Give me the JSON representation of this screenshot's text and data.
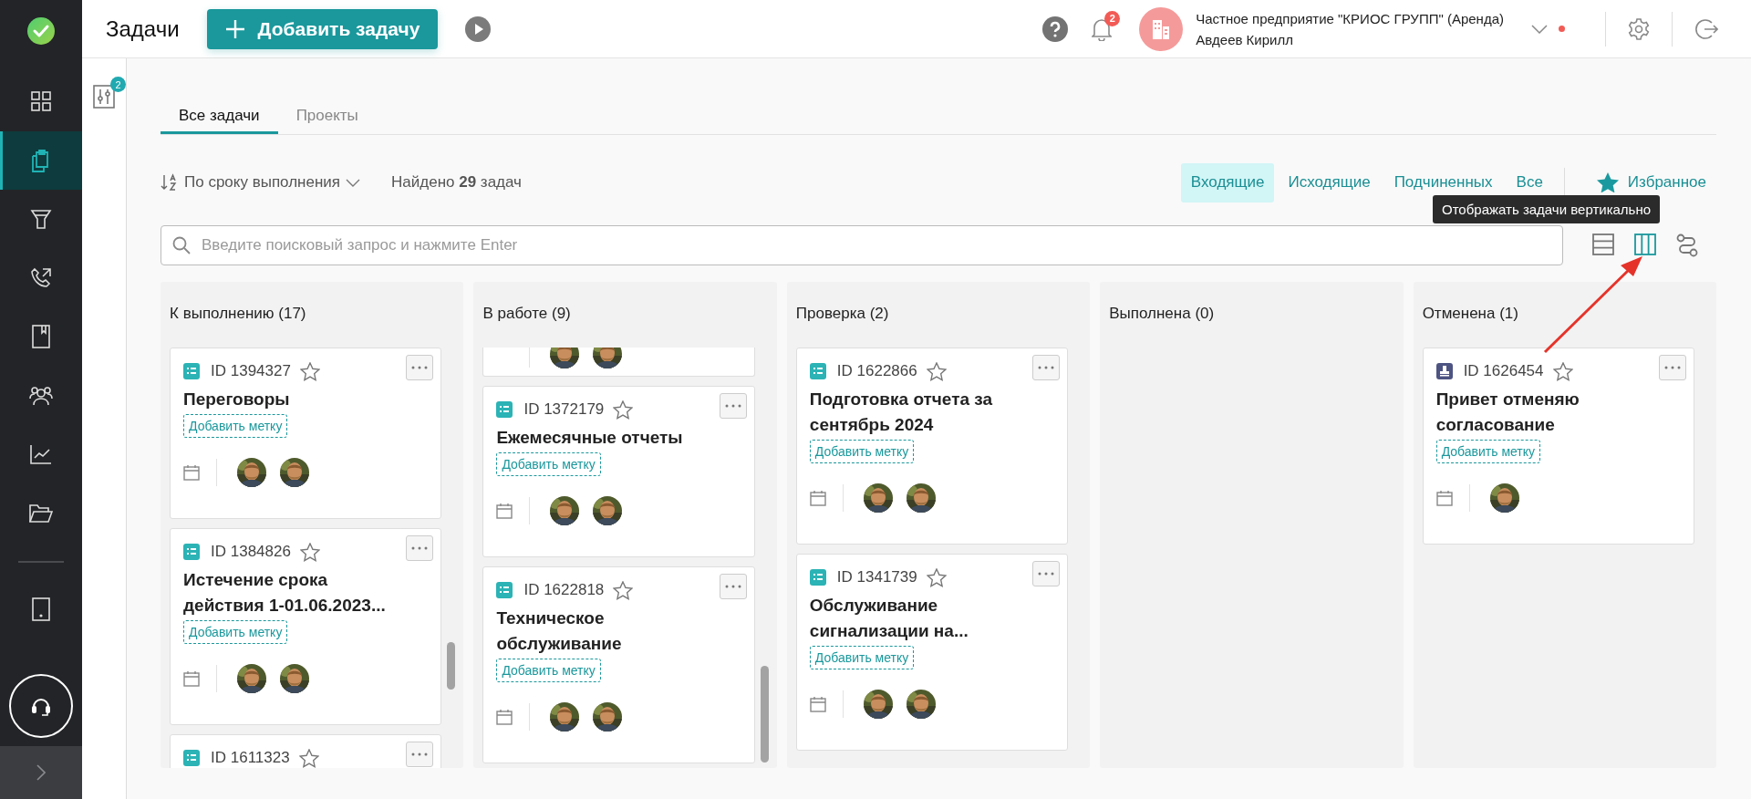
{
  "sidebar": {
    "items": [
      {
        "kind": "grid",
        "selected": false
      },
      {
        "kind": "tasks",
        "selected": true
      },
      {
        "kind": "funnel",
        "selected": false
      },
      {
        "kind": "phone",
        "selected": false
      },
      {
        "kind": "book",
        "selected": false
      },
      {
        "kind": "people",
        "selected": false
      },
      {
        "kind": "chart",
        "selected": false
      },
      {
        "kind": "folder",
        "selected": false
      }
    ],
    "bottom_items": [
      {
        "kind": "tablet",
        "selected": false
      }
    ]
  },
  "header": {
    "title": "Задачи",
    "add_button": "Добавить задачу",
    "notifications_badge": "2",
    "company": "Частное предприятие \"КРИОС ГРУПП\" (Аренда)",
    "user": "Авдеев Кирилл"
  },
  "filter_panel": {
    "badge": "2"
  },
  "tabs": [
    {
      "label": "Все задачи",
      "selected": true
    },
    {
      "label": "Проекты",
      "selected": false
    }
  ],
  "sort": {
    "label": "По сроку выполнения"
  },
  "found": "Найдено **29** задач",
  "scope_tabs": [
    {
      "kind": "plain",
      "label": "Входящие",
      "selected": true
    },
    {
      "kind": "plain",
      "label": "Исходящие",
      "selected": false
    },
    {
      "kind": "plain",
      "label": "Подчиненных",
      "selected": false
    },
    {
      "kind": "plain",
      "label": "Все",
      "selected": false
    },
    {
      "kind": "favorite",
      "label": "Избранное",
      "selected": false
    }
  ],
  "search": {
    "placeholder": "Введите поисковый запрос и нажмите Enter"
  },
  "view_modes": [
    {
      "kind": "list",
      "selected": false
    },
    {
      "kind": "columns",
      "selected": true
    },
    {
      "kind": "flow",
      "selected": false
    }
  ],
  "tooltip": "Отображать задачи вертикально",
  "columns": [
    {
      "title": "К выполнению (17)",
      "cards": [
        {
          "kind": "task",
          "id": "ID 1394327",
          "favorite": false,
          "title": "Переговоры",
          "tag": "Добавить метку"
        },
        {
          "kind": "task",
          "id": "ID 1384826",
          "favorite": false,
          "title": "Истечение срока действия 1-01.06.2023...",
          "tag": "Добавить метку"
        },
        {
          "kind": "task",
          "id": "ID 1611323",
          "favorite": false
        }
      ]
    },
    {
      "title": "В работе (9)",
      "cards": [
        {
          "kind": "clipped"
        },
        {
          "kind": "task",
          "id": "ID 1372179",
          "favorite": false,
          "title": "Ежемесячные отчеты",
          "tag": "Добавить метку"
        },
        {
          "kind": "task",
          "id": "ID 1622818",
          "favorite": false,
          "title": "Техническое обслуживание",
          "tag": "Добавить метку"
        }
      ]
    },
    {
      "title": "Проверка (2)",
      "cards": [
        {
          "kind": "task",
          "id": "ID 1622866",
          "favorite": false,
          "title": "Подготовка отчета за сентябрь 2024",
          "tag": "Добавить метку"
        },
        {
          "kind": "task",
          "id": "ID 1341739",
          "favorite": false,
          "title": "Обслуживание сигнализации на...",
          "tag": "Добавить метку"
        }
      ]
    },
    {
      "title": "Выполнена (0)"
    },
    {
      "title": "Отменена (1)",
      "cards": [
        {
          "kind": "approval",
          "id": "ID 1626454",
          "favorite": false,
          "title": "Привет отменяю согласование",
          "tag": "Добавить метку"
        }
      ]
    }
  ]
}
